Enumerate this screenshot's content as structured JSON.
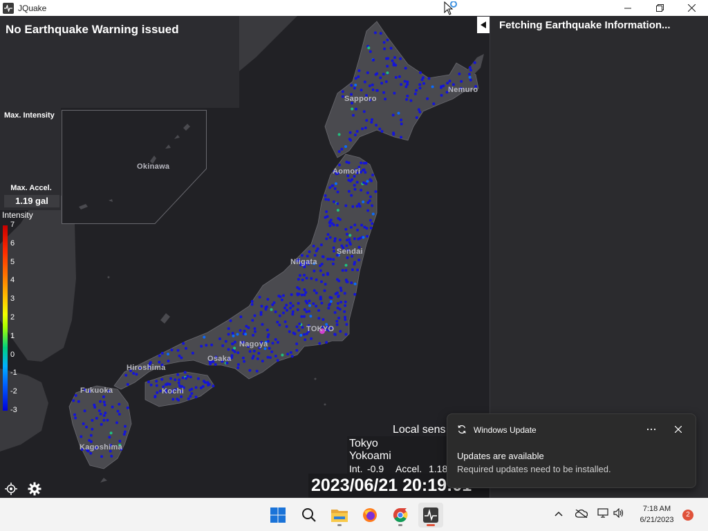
{
  "window": {
    "title": "JQuake"
  },
  "warning": {
    "title": "No Earthquake Warning issued"
  },
  "left_panel": {
    "max_intensity_label": "Max. Intensity",
    "max_accel_label": "Max. Accel.",
    "max_accel_value": "1.19 gal"
  },
  "scale": {
    "title": "Intensity",
    "ticks": [
      "7",
      "6",
      "5",
      "4",
      "3",
      "2",
      "1",
      "0",
      "-1",
      "-2",
      "-3"
    ]
  },
  "map": {
    "labels": {
      "okinawa": "Okinawa",
      "sapporo": "Sapporo",
      "nemuro": "Nemuro",
      "aomori": "Aomori",
      "sendai": "Sendai",
      "niigata": "Niigata",
      "tokyo": "TOKYO",
      "nagoya": "Nagoya",
      "osaka": "Osaka",
      "hiroshima": "Hiroshima",
      "kochi": "Kochi",
      "fukuoka": "Fukuoka",
      "kagoshima": "Kagoshima"
    }
  },
  "local_sensor": {
    "title": "Local sens",
    "city": "Tokyo",
    "area": "Yokoami",
    "int_label": "Int.",
    "int_value": "-0.9",
    "accel_label": "Accel.",
    "accel_value": "1.18"
  },
  "datetime": "2023/06/21 20:19:01",
  "info_panel": {
    "title": "Fetching Earthquake Information..."
  },
  "toast": {
    "app": "Windows Update",
    "heading": "Updates are available",
    "body": "Required updates need to be installed."
  },
  "taskbar": {
    "time": "7:18 AM",
    "date": "6/21/2023",
    "notification_count": "2"
  },
  "colors": {
    "station_dot": "#1414d8",
    "land": "#4a4a4f",
    "sea": "#212125",
    "accent_taskbar": "#e0523a"
  }
}
